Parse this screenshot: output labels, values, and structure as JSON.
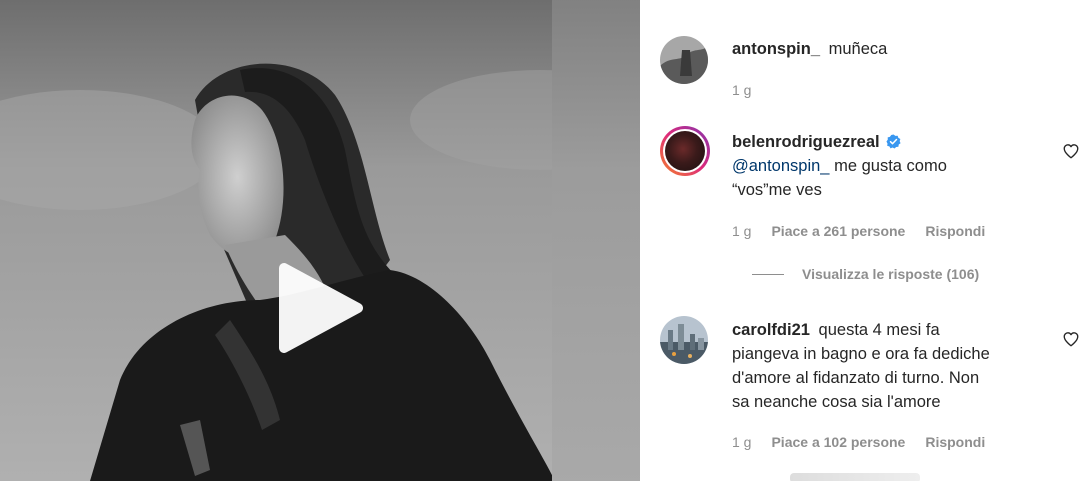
{
  "comments": [
    {
      "username": "antonspin_",
      "text": "muñeca",
      "time": "1 g"
    },
    {
      "username": "belenrodriguezreal",
      "verified": true,
      "mention": "@antonspin_",
      "text_lines": [
        "me gusta como",
        "“vos”me ves"
      ],
      "time": "1 g",
      "likes": "Piace a 261 persone",
      "reply": "Rispondi",
      "view_replies": "Visualizza le risposte (106)"
    },
    {
      "username": "carolfdi21",
      "text_lines": [
        "questa 4 mesi fa",
        "piangeva in bagno e ora fa dediche",
        "d'amore al fidanzato di turno. Non",
        "sa neanche cosa sia l'amore"
      ],
      "time": "1 g",
      "likes": "Piace a 102 persone",
      "reply": "Rispondi"
    }
  ],
  "icons": {
    "play": "play-icon",
    "heart": "heart-outline-icon",
    "verified": "verified-badge-icon"
  },
  "colors": {
    "mention": "#00376b",
    "muted": "#8e8e8e",
    "verified": "#3897f0"
  }
}
